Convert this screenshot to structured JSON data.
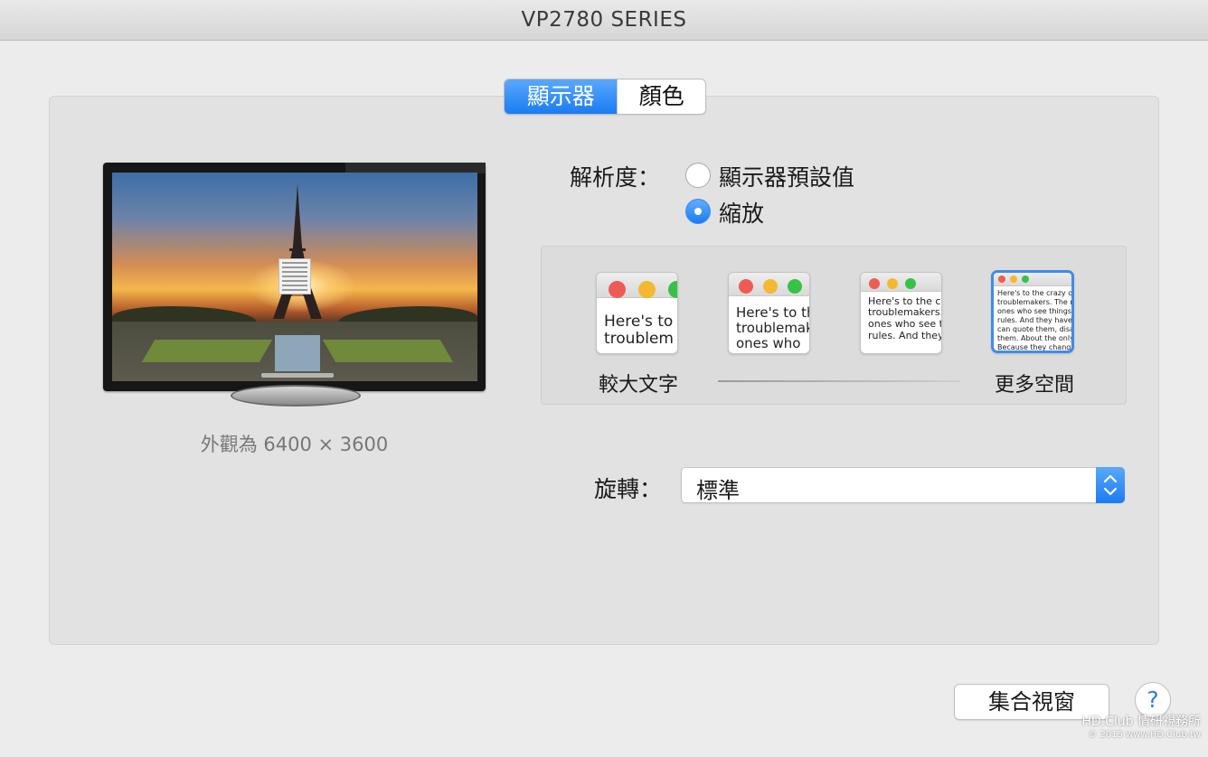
{
  "window": {
    "title": "VP2780 SERIES"
  },
  "tabs": [
    {
      "label": "顯示器",
      "selected": true
    },
    {
      "label": "顏色",
      "selected": false
    }
  ],
  "monitor": {
    "appearance_text": "外觀為 6400 × 3600"
  },
  "resolution": {
    "label": "解析度：",
    "options": [
      {
        "label": "顯示器預設值",
        "selected": false
      },
      {
        "label": "縮放",
        "selected": true
      }
    ]
  },
  "scaling": {
    "left_label": "較大文字",
    "right_label": "更多空間",
    "selected_index": 3,
    "thumbnails": [
      {
        "text": "Here's to\ntroublem"
      },
      {
        "text": "Here's to th\ntroublemak\nones who"
      },
      {
        "text": "Here's to the cr\ntroublemakers.\nones who see t\nrules. And they"
      },
      {
        "text": "Here's to the crazy one\ntroublemakers. The rou\nones who see things di\nrules. And they have no\ncan quote them, disagre\nthem. About the only th\nBecause they change t"
      }
    ]
  },
  "rotation": {
    "label": "旋轉：",
    "value": "標準"
  },
  "footer": {
    "gather_button": "集合視窗",
    "help_label": "?"
  },
  "watermark": {
    "line1": "HD.Club 情研視務所",
    "line2": "© 2015  www.HD.Club.tw"
  },
  "colors": {
    "accent": "#1a7cf3",
    "close": "#ee5b55",
    "minimize": "#f5b832",
    "zoom": "#35c246"
  },
  "icons": [
    "help-icon",
    "select-stepper-icon",
    "close-dot-icon",
    "minimize-dot-icon",
    "zoom-dot-icon"
  ]
}
